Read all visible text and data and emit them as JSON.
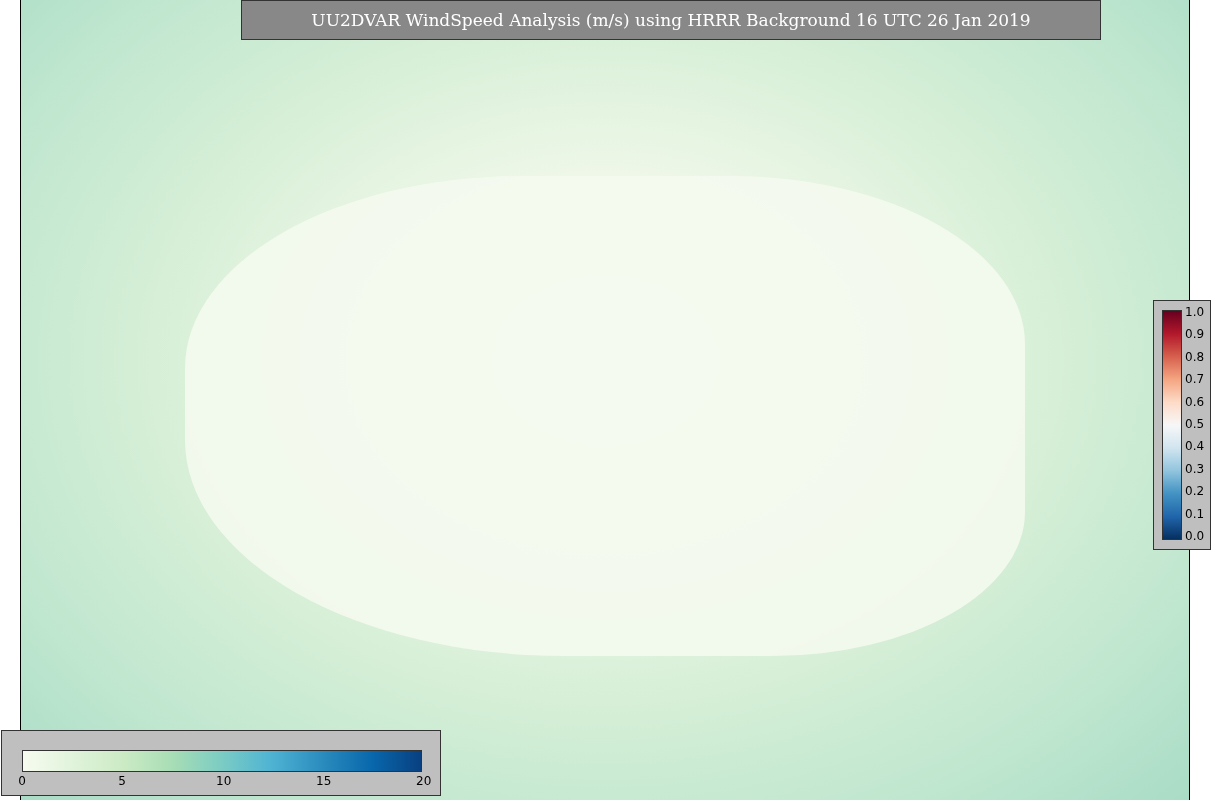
{
  "title": "UU2DVAR WindSpeed Analysis (m/s) using HRRR Background 16 UTC 26 Jan 2019",
  "side_colorbar": {
    "ticks": [
      "1.0",
      "0.9",
      "0.8",
      "0.7",
      "0.6",
      "0.5",
      "0.4",
      "0.3",
      "0.2",
      "0.1",
      "0.0"
    ]
  },
  "bottom_colorbar": {
    "ticks": [
      "0",
      "5",
      "10",
      "15",
      "20"
    ]
  }
}
